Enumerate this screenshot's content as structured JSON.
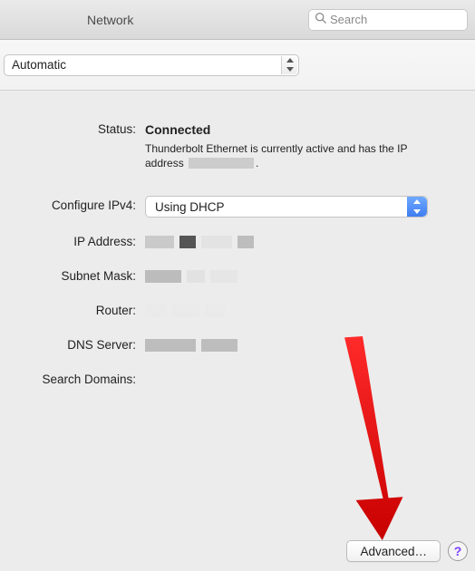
{
  "titlebar": {
    "title": "Network"
  },
  "search": {
    "placeholder": "Search"
  },
  "location": {
    "selected": "Automatic"
  },
  "status": {
    "label": "Status:",
    "value": "Connected",
    "detail_prefix": "Thunderbolt Ethernet is currently active and has the IP address ",
    "detail_suffix": "."
  },
  "fields": {
    "configure_ipv4": {
      "label": "Configure IPv4:",
      "value": "Using DHCP"
    },
    "ip_address": {
      "label": "IP Address:"
    },
    "subnet_mask": {
      "label": "Subnet Mask:"
    },
    "router": {
      "label": "Router:"
    },
    "dns_server": {
      "label": "DNS Server:"
    },
    "search_domains": {
      "label": "Search Domains:"
    }
  },
  "footer": {
    "advanced": "Advanced…",
    "help": "?"
  }
}
